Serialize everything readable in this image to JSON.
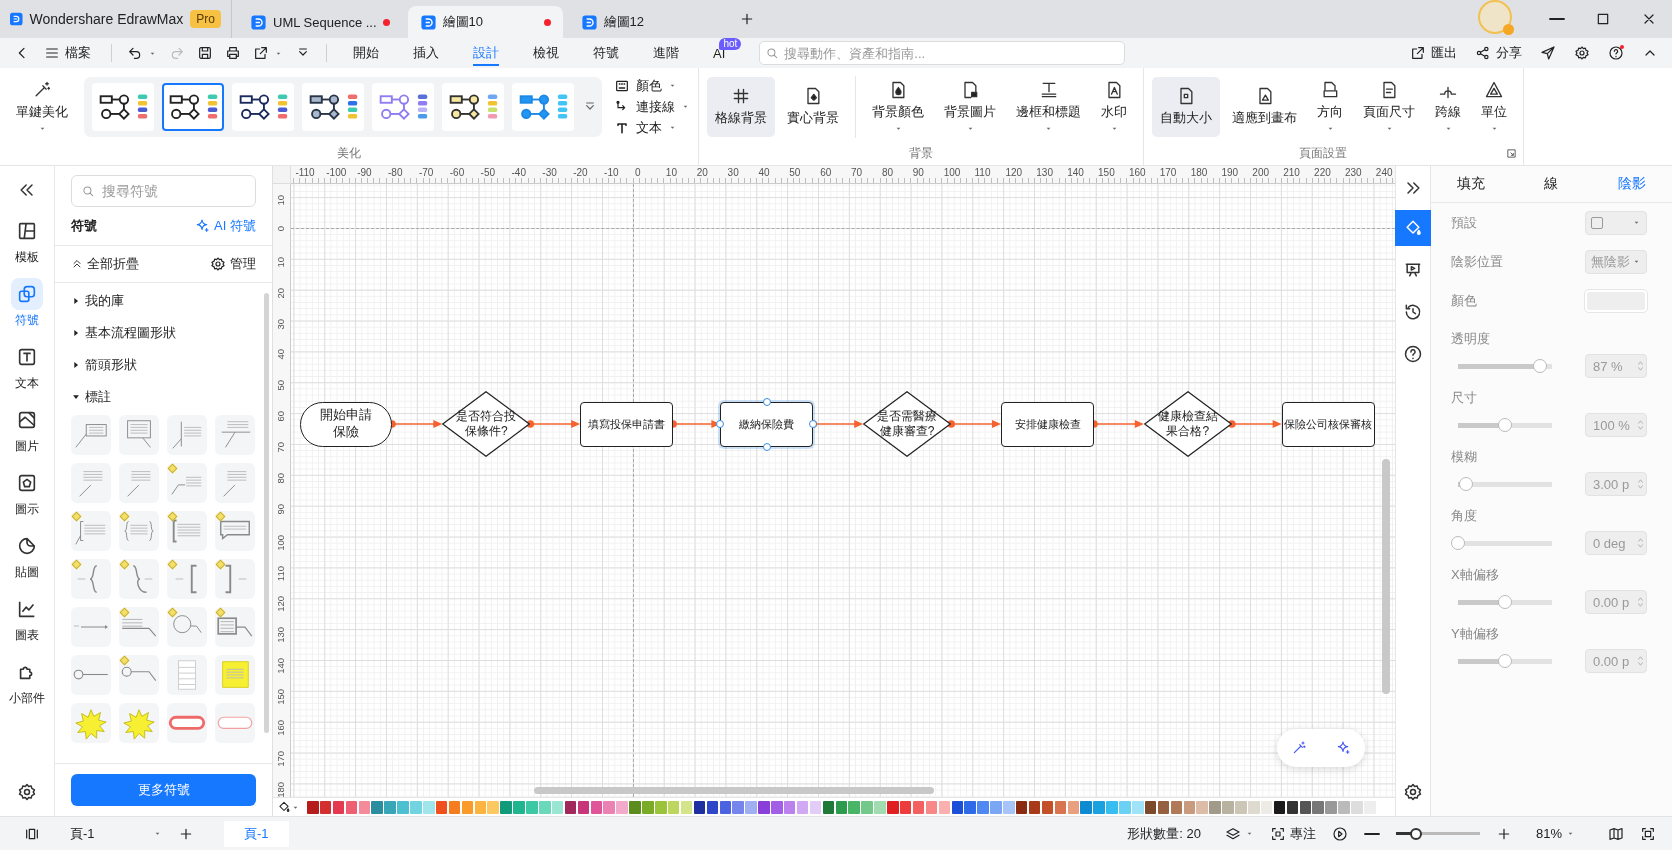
{
  "app": {
    "title": "Wondershare EdrawMax",
    "badge": "Pro"
  },
  "doc_tabs": [
    {
      "title": "UML Sequence ...",
      "selected": false,
      "unsaved": true
    },
    {
      "title": "繪圖10",
      "selected": true,
      "unsaved": true
    },
    {
      "title": "繪圖12",
      "selected": false,
      "unsaved": false
    }
  ],
  "toolbar": {
    "file": "檔案",
    "tools": [
      {
        "kind": "undo",
        "disabled": false,
        "dropdown": true
      },
      {
        "kind": "redo",
        "disabled": true,
        "dropdown": false
      },
      {
        "kind": "save",
        "disabled": false,
        "dropdown": false
      },
      {
        "kind": "print",
        "disabled": false,
        "dropdown": false
      },
      {
        "kind": "export",
        "disabled": false,
        "dropdown": true
      },
      {
        "kind": "more",
        "disabled": false,
        "dropdown": false
      }
    ],
    "tabs": [
      {
        "label": "開始",
        "selected": false
      },
      {
        "label": "插入",
        "selected": false
      },
      {
        "label": "設計",
        "selected": true
      },
      {
        "label": "檢視",
        "selected": false
      },
      {
        "label": "符號",
        "selected": false
      },
      {
        "label": "進階",
        "selected": false
      },
      {
        "label": "AI",
        "selected": false,
        "badge": "hot"
      }
    ],
    "search": {
      "placeholder": "搜尋動作、資產和指南..."
    },
    "actions": [
      {
        "kind": "export",
        "label": "匯出"
      },
      {
        "kind": "share",
        "label": "分享"
      },
      {
        "kind": "send"
      },
      {
        "kind": "settings"
      },
      {
        "kind": "help",
        "alert": true
      },
      {
        "kind": "collapse"
      }
    ]
  },
  "ribbon": {
    "beautify": {
      "button": "單鍵美化",
      "label": "美化",
      "styles": [
        {
          "selected": false,
          "color": "#222222",
          "bars": [
            {
              "color": "#3ec9b0"
            },
            {
              "color": "#f1c232"
            },
            {
              "color": "#4a5bd4"
            },
            {
              "color": "#f06d6d"
            }
          ]
        },
        {
          "selected": true,
          "color": "#222222",
          "bars": [
            {
              "color": "#3ec9b0"
            },
            {
              "color": "#f1c232"
            },
            {
              "color": "#4a5bd4"
            },
            {
              "color": "#f06d6d"
            }
          ]
        },
        {
          "selected": false,
          "color": "#1b2a5e",
          "bars": [
            {
              "color": "#3ec9b0"
            },
            {
              "color": "#f1c232"
            },
            {
              "color": "#4a5bd4"
            },
            {
              "color": "#f06d6d"
            }
          ]
        },
        {
          "selected": false,
          "color": "#2a3548",
          "fill": {
            "color": "#a9b8cc"
          },
          "bars": [
            {
              "color": "#f06d6d"
            },
            {
              "color": "#2f6fed"
            },
            {
              "color": "#3ec9b0"
            },
            {
              "color": "#f1c232"
            }
          ]
        },
        {
          "selected": false,
          "color": "#8f7cf2",
          "bars": [
            {
              "color": "#5b6fd8"
            },
            {
              "color": "#8f7cf2"
            },
            {
              "color": "#b9b2f5"
            },
            {
              "color": "#4c9be8"
            }
          ]
        },
        {
          "selected": false,
          "color": "#333333",
          "fill": {
            "color": "#f7e7a0"
          },
          "bars": [
            {
              "color": "#6ea8ef"
            },
            {
              "color": "#f1c232"
            },
            {
              "color": "#c9e06a"
            },
            {
              "color": "#f29bb0"
            }
          ]
        },
        {
          "selected": false,
          "color": "#1e88e5",
          "fill": {
            "color": "#2196f3"
          },
          "bars": [
            {
              "color": "#42c5f5"
            },
            {
              "color": "#42c5f5"
            },
            {
              "color": "#42c5f5"
            },
            {
              "color": "#42c5f5"
            }
          ]
        }
      ],
      "options": [
        {
          "kind": "color",
          "label": "顏色"
        },
        {
          "kind": "connector",
          "label": "連接線"
        },
        {
          "kind": "text",
          "label": "文本"
        }
      ]
    },
    "background": {
      "label": "背景",
      "modes": [
        {
          "kind": "grid",
          "label": "格線背景",
          "on": true,
          "dropdown": false
        },
        {
          "kind": "solid",
          "label": "實心背景",
          "on": false,
          "dropdown": false
        }
      ],
      "tools": [
        {
          "kind": "bg-color",
          "label": "背景顏色",
          "on": false,
          "dropdown": true
        },
        {
          "kind": "bg-image",
          "label": "背景圖片",
          "on": false,
          "dropdown": true
        },
        {
          "kind": "border",
          "label": "邊框和標題",
          "on": false,
          "dropdown": true
        },
        {
          "kind": "watermark",
          "label": "水印",
          "on": false,
          "dropdown": true
        }
      ]
    },
    "page_setup": {
      "label": "頁面設置",
      "buttons": [
        {
          "kind": "auto-size",
          "label": "自動大小",
          "on": true,
          "dropdown": false
        },
        {
          "kind": "fit",
          "label": "適應到畫布",
          "on": false,
          "dropdown": false
        },
        {
          "kind": "orientation",
          "label": "方向",
          "on": false,
          "dropdown": true
        },
        {
          "kind": "page-size",
          "label": "頁面尺寸",
          "on": false,
          "dropdown": true
        },
        {
          "kind": "jump",
          "label": "跨線",
          "on": false,
          "dropdown": true
        },
        {
          "kind": "unit",
          "label": "單位",
          "on": false,
          "dropdown": true
        }
      ]
    }
  },
  "side_rail": {
    "items": [
      {
        "kind": "template",
        "label": "模板",
        "selected": false
      },
      {
        "kind": "symbols",
        "label": "符號",
        "selected": true
      },
      {
        "kind": "text",
        "label": "文本",
        "selected": false
      },
      {
        "kind": "image",
        "label": "圖片",
        "selected": false
      },
      {
        "kind": "icon",
        "label": "圖示",
        "selected": false
      },
      {
        "kind": "sticker",
        "label": "貼圖",
        "selected": false
      },
      {
        "kind": "chart",
        "label": "圖表",
        "selected": false
      },
      {
        "kind": "widget",
        "label": "小部件",
        "selected": false
      }
    ]
  },
  "symbol_panel": {
    "search": {
      "placeholder": "搜尋符號"
    },
    "title": "符號",
    "ai_link": "AI 符號",
    "collapse_all": "全部折疊",
    "manage": "管理",
    "libraries": [
      {
        "label": "我的庫",
        "expanded": false
      },
      {
        "label": "基本流程圖形狀",
        "expanded": false
      },
      {
        "label": "箭頭形狀",
        "expanded": false
      },
      {
        "label": "標註",
        "expanded": true
      }
    ],
    "shapes": [
      {
        "kind": "box-line",
        "marker": false
      },
      {
        "kind": "box-tail",
        "marker": false
      },
      {
        "kind": "bar-line",
        "marker": false
      },
      {
        "kind": "under-line",
        "marker": false
      },
      {
        "kind": "diag-text",
        "marker": false
      },
      {
        "kind": "diag-text",
        "marker": false
      },
      {
        "kind": "elbow-text",
        "marker": true
      },
      {
        "kind": "diag-text",
        "marker": false
      },
      {
        "kind": "bracket-box",
        "marker": true
      },
      {
        "kind": "brace-text",
        "marker": true
      },
      {
        "kind": "bracket-text",
        "marker": true
      },
      {
        "kind": "speech-box",
        "marker": true
      },
      {
        "kind": "brace-left",
        "marker": true
      },
      {
        "kind": "brace-right",
        "marker": true
      },
      {
        "kind": "square-left",
        "marker": true
      },
      {
        "kind": "square-right",
        "marker": true
      },
      {
        "kind": "arrow-line",
        "marker": false
      },
      {
        "kind": "elbow-line",
        "marker": true
      },
      {
        "kind": "circle-callout",
        "marker": true
      },
      {
        "kind": "box-callout",
        "marker": true
      },
      {
        "kind": "circle-line",
        "marker": false
      },
      {
        "kind": "circle-elbow",
        "marker": true
      },
      {
        "kind": "table",
        "marker": false
      },
      {
        "kind": "sticky",
        "marker": false
      },
      {
        "kind": "starburst",
        "marker": false
      },
      {
        "kind": "starburst",
        "marker": false
      },
      {
        "kind": "pill-red",
        "marker": false
      },
      {
        "kind": "pill-outline",
        "marker": false
      }
    ],
    "more_button": "更多符號"
  },
  "canvas": {
    "x_ticks": [
      "-110",
      "-100",
      "-90",
      "-80",
      "-70",
      "-60",
      "-50",
      "-40",
      "-30",
      "-20",
      "-10",
      "0",
      "10",
      "20",
      "30",
      "40",
      "50",
      "60",
      "70",
      "80",
      "90",
      "100",
      "110",
      "120",
      "130",
      "140",
      "150",
      "160",
      "170",
      "180",
      "190",
      "200",
      "210",
      "220",
      "230",
      "240"
    ],
    "y_ticks": [
      "10",
      "0",
      "10",
      "20",
      "30",
      "40",
      "50",
      "60",
      "70",
      "80",
      "90",
      "100",
      "110",
      "120",
      "130",
      "140",
      "150",
      "160",
      "170",
      "180"
    ],
    "nodes": [
      {
        "kind": "terminal",
        "label": "開始申請保險",
        "selected": false
      },
      {
        "kind": "decision",
        "label": "是否符合投保條件?",
        "selected": false
      },
      {
        "kind": "process",
        "label": "填寫投保申請書",
        "selected": false
      },
      {
        "kind": "process",
        "label": "繳納保險費",
        "selected": true
      },
      {
        "kind": "decision",
        "label": "是否需醫療健康審查?",
        "selected": false
      },
      {
        "kind": "process",
        "label": "安排健康檢查",
        "selected": false
      },
      {
        "kind": "decision",
        "label": "健康檢查結果合格?",
        "selected": false
      },
      {
        "kind": "process",
        "label": "保險公司核保審核",
        "selected": false
      }
    ]
  },
  "palette": {
    "swatches": [
      {
        "color": "#b71c1c"
      },
      {
        "color": "#d32f2f"
      },
      {
        "color": "#e53950"
      },
      {
        "color": "#ef5f74"
      },
      {
        "color": "#f48a9a"
      },
      {
        "color": "#2a8ea0"
      },
      {
        "color": "#36a6b8"
      },
      {
        "color": "#4cc0d0"
      },
      {
        "color": "#72d4e0"
      },
      {
        "color": "#a0e4ec"
      },
      {
        "color": "#f0501e"
      },
      {
        "color": "#f57c1f"
      },
      {
        "color": "#fa9a28"
      },
      {
        "color": "#fbb440"
      },
      {
        "color": "#fcc860"
      },
      {
        "color": "#129b7a"
      },
      {
        "color": "#1fb58f"
      },
      {
        "color": "#3cc8a4"
      },
      {
        "color": "#6ad8bb"
      },
      {
        "color": "#9ae6d2"
      },
      {
        "color": "#a0285a"
      },
      {
        "color": "#c8367a"
      },
      {
        "color": "#e0559a"
      },
      {
        "color": "#ec82b4"
      },
      {
        "color": "#f2aacb"
      },
      {
        "color": "#5c8c1e"
      },
      {
        "color": "#7aab26"
      },
      {
        "color": "#9cc43a"
      },
      {
        "color": "#bcd65e"
      },
      {
        "color": "#d4e48a"
      },
      {
        "color": "#1e2fa0"
      },
      {
        "color": "#2f46c8"
      },
      {
        "color": "#4b63e0"
      },
      {
        "color": "#7585ec"
      },
      {
        "color": "#a0aef2"
      },
      {
        "color": "#8a3fd8"
      },
      {
        "color": "#a25fe6"
      },
      {
        "color": "#bb82ee"
      },
      {
        "color": "#d0a8f4"
      },
      {
        "color": "#e3ccf8"
      },
      {
        "color": "#1f7a3a"
      },
      {
        "color": "#2e9a4e"
      },
      {
        "color": "#48b466"
      },
      {
        "color": "#72c98a"
      },
      {
        "color": "#a0dcb0"
      },
      {
        "color": "#e02020"
      },
      {
        "color": "#ec3c3c"
      },
      {
        "color": "#f46060"
      },
      {
        "color": "#f88888"
      },
      {
        "color": "#fbb0b0"
      },
      {
        "color": "#1c4fd8"
      },
      {
        "color": "#2e6ae8"
      },
      {
        "color": "#4f88f0"
      },
      {
        "color": "#7aa6f4"
      },
      {
        "color": "#a6c4f8"
      },
      {
        "color": "#8a2a10"
      },
      {
        "color": "#a83a1a"
      },
      {
        "color": "#c4502a"
      },
      {
        "color": "#d87450"
      },
      {
        "color": "#e8a080"
      },
      {
        "color": "#0e8ad0"
      },
      {
        "color": "#1aa2e0"
      },
      {
        "color": "#38bdf0"
      },
      {
        "color": "#6cd2f4"
      },
      {
        "color": "#a0e2f8"
      },
      {
        "color": "#7a4a2a"
      },
      {
        "color": "#946040"
      },
      {
        "color": "#b07a58"
      },
      {
        "color": "#c89a7e"
      },
      {
        "color": "#dcbca6"
      },
      {
        "color": "#a09a88"
      },
      {
        "color": "#b8b2a0"
      },
      {
        "color": "#ccc6b6"
      },
      {
        "color": "#dedad0"
      },
      {
        "color": "#ecebe6"
      },
      {
        "color": "#1a1a1a"
      },
      {
        "color": "#333333"
      },
      {
        "color": "#555555"
      },
      {
        "color": "#777777"
      },
      {
        "color": "#999999"
      },
      {
        "color": "#bbbbbb"
      },
      {
        "color": "#dddddd"
      },
      {
        "color": "#eeeeee"
      }
    ]
  },
  "right_rail": {
    "items": [
      {
        "kind": "fill",
        "selected": true
      },
      {
        "kind": "present",
        "selected": false
      },
      {
        "kind": "history",
        "selected": false
      },
      {
        "kind": "help",
        "selected": false
      }
    ]
  },
  "properties": {
    "tabs": [
      {
        "label": "填充",
        "selected": false
      },
      {
        "label": "線",
        "selected": false
      },
      {
        "label": "陰影",
        "selected": true
      }
    ],
    "preset": {
      "label": "預設"
    },
    "position": {
      "label": "陰影位置",
      "value": "無陰影"
    },
    "color": {
      "label": "顏色"
    },
    "sliders": [
      {
        "label": "透明度",
        "level": 0.87,
        "reading": "87 %"
      },
      {
        "label": "尺寸",
        "level": 0.5,
        "reading": "100 %"
      },
      {
        "label": "模糊",
        "level": 0.09,
        "reading": "3.00 p"
      },
      {
        "label": "角度",
        "level": 0.0,
        "reading": "0 deg"
      },
      {
        "label": "X軸偏移",
        "level": 0.5,
        "reading": "0.00 p"
      },
      {
        "label": "Y軸偏移",
        "level": 0.5,
        "reading": "0.00 p"
      }
    ]
  },
  "status_bar": {
    "page_select": "頁-1",
    "page_tabs": [
      {
        "label": "頁-1",
        "selected": true
      }
    ],
    "shape_count": "形狀數量: 20",
    "focus": "專注",
    "zoom": {
      "level": 0.24,
      "reading": "81%"
    }
  }
}
